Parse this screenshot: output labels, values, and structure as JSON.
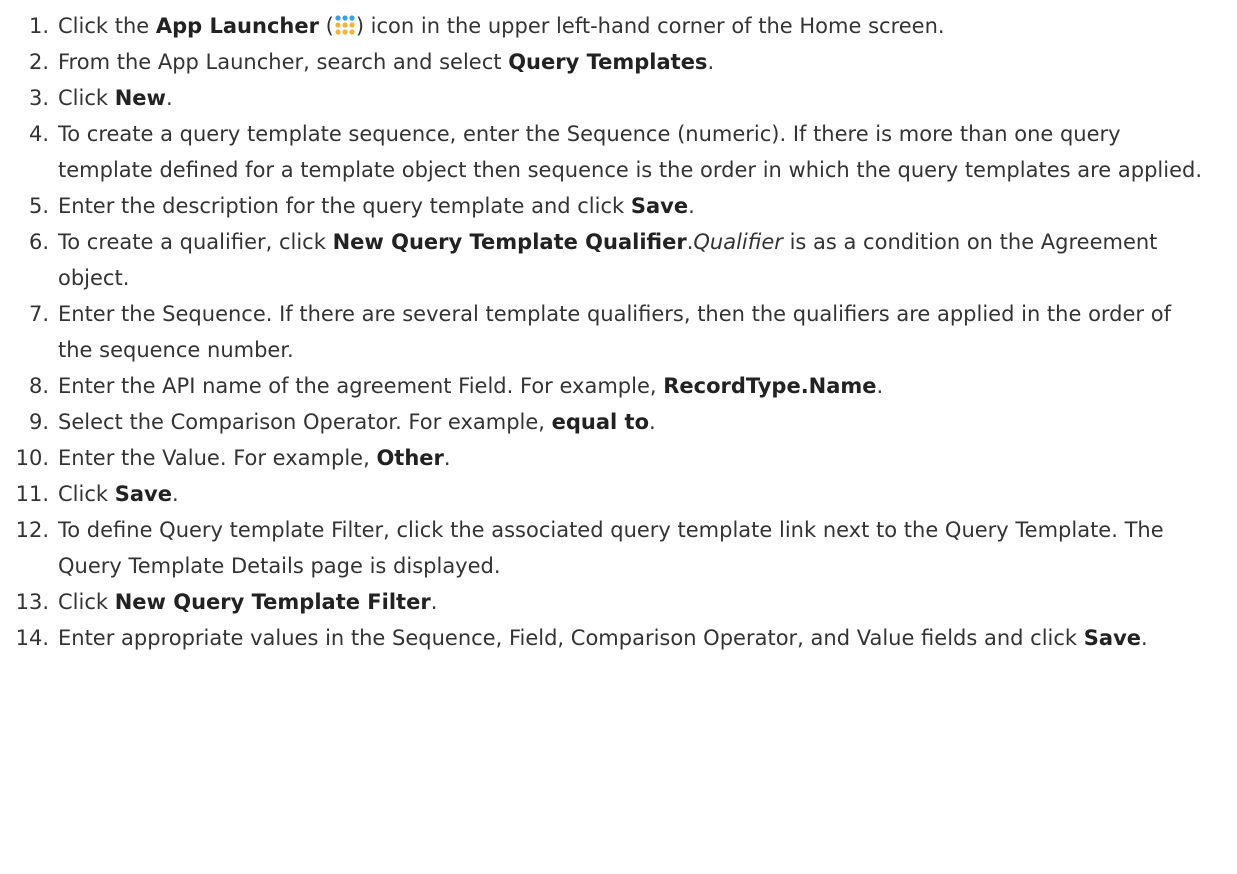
{
  "steps": [
    {
      "number": "1.",
      "parts": [
        {
          "text": "Click the "
        },
        {
          "text": "App Launcher",
          "bold": true
        },
        {
          "text": " ("
        },
        {
          "icon": "app-launcher-icon"
        },
        {
          "text": ") icon in the upper left-hand corner of the Home screen."
        }
      ]
    },
    {
      "number": "2.",
      "parts": [
        {
          "text": "From the App Launcher, search and select "
        },
        {
          "text": "Query Templates",
          "bold": true
        },
        {
          "text": "."
        }
      ]
    },
    {
      "number": "3.",
      "parts": [
        {
          "text": "Click "
        },
        {
          "text": "New",
          "bold": true
        },
        {
          "text": "."
        }
      ]
    },
    {
      "number": "4.",
      "parts": [
        {
          "text": "To create a query template sequence, enter the Sequence (numeric). If there is more than one query template defined for a template object then sequence is the order in which the query templates are applied."
        }
      ]
    },
    {
      "number": "5.",
      "parts": [
        {
          "text": "Enter the description for the query template and click "
        },
        {
          "text": "Save",
          "bold": true
        },
        {
          "text": "."
        }
      ]
    },
    {
      "number": "6.",
      "parts": [
        {
          "text": "To create a qualifier, click "
        },
        {
          "text": "New Query Template Qualifier",
          "bold": true
        },
        {
          "text": "."
        },
        {
          "text": "Qualifier",
          "italic": true
        },
        {
          "text": " is as a condition on the Agreement object."
        }
      ]
    },
    {
      "number": "7.",
      "parts": [
        {
          "text": "Enter the Sequence. If there are several template qualifiers, then the qualifiers are applied in the order of the sequence number."
        }
      ]
    },
    {
      "number": "8.",
      "parts": [
        {
          "text": "Enter the API name of the agreement Field. For example, "
        },
        {
          "text": "RecordType.Name",
          "bold": true
        },
        {
          "text": "."
        }
      ]
    },
    {
      "number": "9.",
      "parts": [
        {
          "text": "Select the Comparison Operator. For example, "
        },
        {
          "text": "equal to",
          "bold": true
        },
        {
          "text": "."
        }
      ]
    },
    {
      "number": "10.",
      "parts": [
        {
          "text": "Enter the Value. For example, "
        },
        {
          "text": "Other",
          "bold": true
        },
        {
          "text": "."
        }
      ]
    },
    {
      "number": "11.",
      "parts": [
        {
          "text": "Click "
        },
        {
          "text": "Save",
          "bold": true
        },
        {
          "text": "."
        }
      ]
    },
    {
      "number": "12.",
      "parts": [
        {
          "text": "To define Query template Filter, click the associated query template link next to the Query Template. The Query Template Details page is displayed."
        }
      ]
    },
    {
      "number": "13.",
      "parts": [
        {
          "text": "Click "
        },
        {
          "text": "New Query Template Filter",
          "bold": true
        },
        {
          "text": "."
        }
      ]
    },
    {
      "number": "14.",
      "parts": [
        {
          "text": "Enter appropriate values in the Sequence, Field, Comparison Operator, and Value fields and click "
        },
        {
          "text": "Save",
          "bold": true
        },
        {
          "text": "."
        }
      ]
    }
  ],
  "colors": {
    "text": "#333333",
    "launcher_dots": [
      "#3ba1e6",
      "#3ba1e6",
      "#3ba1e6",
      "#f5b335",
      "#f5b335",
      "#f5b335",
      "#f5b335",
      "#f5b335",
      "#f5b335"
    ]
  }
}
